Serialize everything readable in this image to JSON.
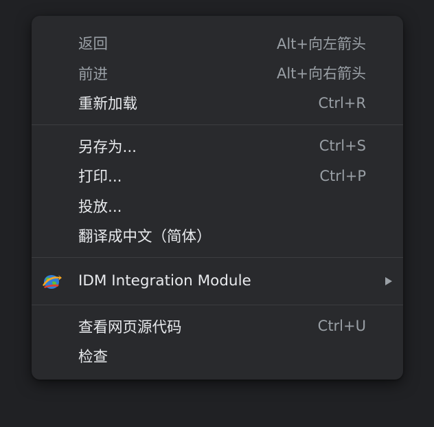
{
  "menu": {
    "back": {
      "label": "返回",
      "shortcut": "Alt+向左箭头"
    },
    "forward": {
      "label": "前进",
      "shortcut": "Alt+向右箭头"
    },
    "reload": {
      "label": "重新加载",
      "shortcut": "Ctrl+R"
    },
    "save_as": {
      "label": "另存为...",
      "shortcut": "Ctrl+S"
    },
    "print": {
      "label": "打印...",
      "shortcut": "Ctrl+P"
    },
    "cast": {
      "label": "投放..."
    },
    "translate": {
      "label": "翻译成中文（简体）"
    },
    "idm": {
      "label": "IDM Integration Module",
      "icon": "idm-globe-icon"
    },
    "view_source": {
      "label": "查看网页源代码",
      "shortcut": "Ctrl+U"
    },
    "inspect": {
      "label": "检查"
    }
  },
  "colors": {
    "background": "#202124",
    "menu_bg": "#292a2d",
    "text": "#e8eaed",
    "muted": "#9aa0a6",
    "separator": "#3c3d40"
  }
}
